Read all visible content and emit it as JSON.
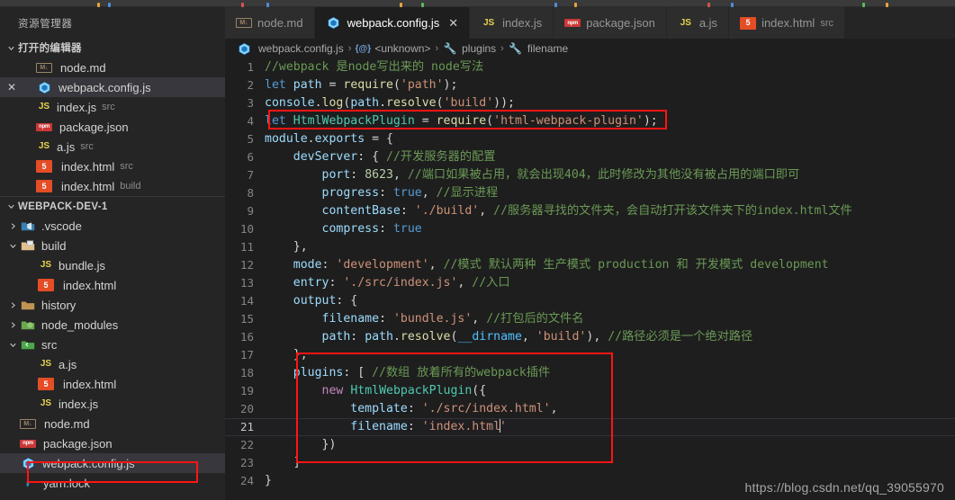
{
  "window": {
    "sidebar_title": "资源管理器"
  },
  "sidebar": {
    "open_editors_label": "打开的编辑器",
    "open_editors": [
      {
        "name": "node.md",
        "sub": "",
        "icon": "markdown-icon",
        "selected": false,
        "has_close": false
      },
      {
        "name": "webpack.config.js",
        "sub": "",
        "icon": "webpack-icon",
        "selected": true,
        "has_close": true
      },
      {
        "name": "index.js",
        "sub": "src",
        "icon": "js-icon",
        "selected": false,
        "has_close": false
      },
      {
        "name": "package.json",
        "sub": "",
        "icon": "npm-icon",
        "selected": false,
        "has_close": false
      },
      {
        "name": "a.js",
        "sub": "src",
        "icon": "js-icon",
        "selected": false,
        "has_close": false
      },
      {
        "name": "index.html",
        "sub": "src",
        "icon": "html-icon",
        "selected": false,
        "has_close": false
      },
      {
        "name": "index.html",
        "sub": "build",
        "icon": "html-icon",
        "selected": false,
        "has_close": false
      }
    ],
    "project_label": "WEBPACK-DEV-1",
    "tree": [
      {
        "name": ".vscode",
        "type": "folder",
        "state": "collapsed",
        "depth": 1,
        "icon": "folder-vscode-icon"
      },
      {
        "name": "build",
        "type": "folder",
        "state": "expanded",
        "depth": 1,
        "icon": "folder-build-icon"
      },
      {
        "name": "bundle.js",
        "type": "file",
        "depth": 2,
        "icon": "js-icon"
      },
      {
        "name": "index.html",
        "type": "file",
        "depth": 2,
        "icon": "html-icon"
      },
      {
        "name": "history",
        "type": "folder",
        "state": "collapsed",
        "depth": 1,
        "icon": "folder-icon"
      },
      {
        "name": "node_modules",
        "type": "folder",
        "state": "collapsed",
        "depth": 1,
        "icon": "folder-node-icon"
      },
      {
        "name": "src",
        "type": "folder",
        "state": "expanded",
        "depth": 1,
        "icon": "folder-src-icon"
      },
      {
        "name": "a.js",
        "type": "file",
        "depth": 2,
        "icon": "js-icon"
      },
      {
        "name": "index.html",
        "type": "file",
        "depth": 2,
        "icon": "html-icon"
      },
      {
        "name": "index.js",
        "type": "file",
        "depth": 2,
        "icon": "js-icon"
      },
      {
        "name": "node.md",
        "type": "file",
        "depth": 1,
        "icon": "markdown-icon"
      },
      {
        "name": "package.json",
        "type": "file",
        "depth": 1,
        "icon": "npm-icon"
      },
      {
        "name": "webpack.config.js",
        "type": "file",
        "depth": 1,
        "icon": "webpack-icon",
        "selected": true,
        "annotated": true
      },
      {
        "name": "yarn.lock",
        "type": "file",
        "depth": 1,
        "icon": "yarn-icon"
      }
    ]
  },
  "tabs": [
    {
      "label": "node.md",
      "sub": "",
      "icon": "markdown-icon",
      "active": false,
      "closable": false
    },
    {
      "label": "webpack.config.js",
      "sub": "",
      "icon": "webpack-icon",
      "active": true,
      "closable": true
    },
    {
      "label": "index.js",
      "sub": "",
      "icon": "js-icon",
      "active": false,
      "closable": false
    },
    {
      "label": "package.json",
      "sub": "",
      "icon": "npm-icon",
      "active": false,
      "closable": false
    },
    {
      "label": "a.js",
      "sub": "",
      "icon": "js-icon",
      "active": false,
      "closable": false
    },
    {
      "label": "index.html",
      "sub": "src",
      "icon": "html-icon",
      "active": false,
      "closable": false
    }
  ],
  "breadcrumb": [
    {
      "label": "webpack.config.js",
      "icon": "webpack-icon"
    },
    {
      "label": "<unknown>",
      "icon": "symbol-object-icon"
    },
    {
      "label": "plugins",
      "icon": "wrench-icon"
    },
    {
      "label": "filename",
      "icon": "wrench-icon"
    }
  ],
  "editor": {
    "language": "javascript",
    "active_line": 21,
    "cursor_line": 21,
    "lines": [
      {
        "n": 1,
        "tokens": [
          {
            "t": "//webpack 是node写出来的 node写法",
            "c": "cmt"
          }
        ]
      },
      {
        "n": 2,
        "tokens": [
          {
            "t": "let",
            "c": "kw"
          },
          {
            "t": " ",
            "c": "plain"
          },
          {
            "t": "path",
            "c": "var"
          },
          {
            "t": " = ",
            "c": "plain"
          },
          {
            "t": "require",
            "c": "fn"
          },
          {
            "t": "(",
            "c": "plain"
          },
          {
            "t": "'path'",
            "c": "str"
          },
          {
            "t": ");",
            "c": "plain"
          }
        ]
      },
      {
        "n": 3,
        "tokens": [
          {
            "t": "console",
            "c": "var"
          },
          {
            "t": ".",
            "c": "plain"
          },
          {
            "t": "log",
            "c": "fn"
          },
          {
            "t": "(",
            "c": "plain"
          },
          {
            "t": "path",
            "c": "var"
          },
          {
            "t": ".",
            "c": "plain"
          },
          {
            "t": "resolve",
            "c": "fn"
          },
          {
            "t": "(",
            "c": "plain"
          },
          {
            "t": "'build'",
            "c": "str"
          },
          {
            "t": "));",
            "c": "plain"
          }
        ]
      },
      {
        "n": 4,
        "tokens": [
          {
            "t": "let",
            "c": "kw"
          },
          {
            "t": " ",
            "c": "plain"
          },
          {
            "t": "HtmlWebpackPlugin",
            "c": "cls"
          },
          {
            "t": " = ",
            "c": "plain"
          },
          {
            "t": "require",
            "c": "fn"
          },
          {
            "t": "(",
            "c": "plain"
          },
          {
            "t": "'html-webpack-plugin'",
            "c": "str"
          },
          {
            "t": ");",
            "c": "plain"
          }
        ]
      },
      {
        "n": 5,
        "tokens": [
          {
            "t": "module",
            "c": "var"
          },
          {
            "t": ".",
            "c": "plain"
          },
          {
            "t": "exports",
            "c": "var"
          },
          {
            "t": " = {",
            "c": "plain"
          }
        ]
      },
      {
        "n": 6,
        "tokens": [
          {
            "t": "    ",
            "c": "plain"
          },
          {
            "t": "devServer",
            "c": "var"
          },
          {
            "t": ": { ",
            "c": "plain"
          },
          {
            "t": "//开发服务器的配置",
            "c": "cmt"
          }
        ]
      },
      {
        "n": 7,
        "tokens": [
          {
            "t": "        ",
            "c": "plain"
          },
          {
            "t": "port",
            "c": "var"
          },
          {
            "t": ": ",
            "c": "plain"
          },
          {
            "t": "8623",
            "c": "num"
          },
          {
            "t": ", ",
            "c": "plain"
          },
          {
            "t": "//端口如果被占用，就会出现404，此时修改为其他没有被占用的端口即可",
            "c": "cmt"
          }
        ]
      },
      {
        "n": 8,
        "tokens": [
          {
            "t": "        ",
            "c": "plain"
          },
          {
            "t": "progress",
            "c": "var"
          },
          {
            "t": ": ",
            "c": "plain"
          },
          {
            "t": "true",
            "c": "kw"
          },
          {
            "t": ", ",
            "c": "plain"
          },
          {
            "t": "//显示进程",
            "c": "cmt"
          }
        ]
      },
      {
        "n": 9,
        "tokens": [
          {
            "t": "        ",
            "c": "plain"
          },
          {
            "t": "contentBase",
            "c": "var"
          },
          {
            "t": ": ",
            "c": "plain"
          },
          {
            "t": "'./build'",
            "c": "str"
          },
          {
            "t": ", ",
            "c": "plain"
          },
          {
            "t": "//服务器寻找的文件夹，会自动打开该文件夹下的index.html文件",
            "c": "cmt"
          }
        ]
      },
      {
        "n": 10,
        "tokens": [
          {
            "t": "        ",
            "c": "plain"
          },
          {
            "t": "compress",
            "c": "var"
          },
          {
            "t": ": ",
            "c": "plain"
          },
          {
            "t": "true",
            "c": "kw"
          }
        ]
      },
      {
        "n": 11,
        "tokens": [
          {
            "t": "    },",
            "c": "plain"
          }
        ]
      },
      {
        "n": 12,
        "tokens": [
          {
            "t": "    ",
            "c": "plain"
          },
          {
            "t": "mode",
            "c": "var"
          },
          {
            "t": ": ",
            "c": "plain"
          },
          {
            "t": "'development'",
            "c": "str"
          },
          {
            "t": ", ",
            "c": "plain"
          },
          {
            "t": "//模式 默认两种 生产模式 production 和 开发模式 development",
            "c": "cmt"
          }
        ]
      },
      {
        "n": 13,
        "tokens": [
          {
            "t": "    ",
            "c": "plain"
          },
          {
            "t": "entry",
            "c": "var"
          },
          {
            "t": ": ",
            "c": "plain"
          },
          {
            "t": "'./src/index.js'",
            "c": "str"
          },
          {
            "t": ", ",
            "c": "plain"
          },
          {
            "t": "//入口",
            "c": "cmt"
          }
        ]
      },
      {
        "n": 14,
        "tokens": [
          {
            "t": "    ",
            "c": "plain"
          },
          {
            "t": "output",
            "c": "var"
          },
          {
            "t": ": {",
            "c": "plain"
          }
        ]
      },
      {
        "n": 15,
        "tokens": [
          {
            "t": "        ",
            "c": "plain"
          },
          {
            "t": "filename",
            "c": "var"
          },
          {
            "t": ": ",
            "c": "plain"
          },
          {
            "t": "'bundle.js'",
            "c": "str"
          },
          {
            "t": ", ",
            "c": "plain"
          },
          {
            "t": "//打包后的文件名",
            "c": "cmt"
          }
        ]
      },
      {
        "n": 16,
        "tokens": [
          {
            "t": "        ",
            "c": "plain"
          },
          {
            "t": "path",
            "c": "var"
          },
          {
            "t": ": ",
            "c": "plain"
          },
          {
            "t": "path",
            "c": "var"
          },
          {
            "t": ".",
            "c": "plain"
          },
          {
            "t": "resolve",
            "c": "fn"
          },
          {
            "t": "(",
            "c": "plain"
          },
          {
            "t": "__dirname",
            "c": "const"
          },
          {
            "t": ", ",
            "c": "plain"
          },
          {
            "t": "'build'",
            "c": "str"
          },
          {
            "t": "), ",
            "c": "plain"
          },
          {
            "t": "//路径必须是一个绝对路径",
            "c": "cmt"
          }
        ]
      },
      {
        "n": 17,
        "tokens": [
          {
            "t": "    },",
            "c": "plain"
          }
        ]
      },
      {
        "n": 18,
        "tokens": [
          {
            "t": "    ",
            "c": "plain"
          },
          {
            "t": "plugins",
            "c": "var"
          },
          {
            "t": ": [ ",
            "c": "plain"
          },
          {
            "t": "//数组 放着所有的webpack插件",
            "c": "cmt"
          }
        ]
      },
      {
        "n": 19,
        "tokens": [
          {
            "t": "        ",
            "c": "plain"
          },
          {
            "t": "new",
            "c": "kw2"
          },
          {
            "t": " ",
            "c": "plain"
          },
          {
            "t": "HtmlWebpackPlugin",
            "c": "cls"
          },
          {
            "t": "({",
            "c": "plain"
          }
        ]
      },
      {
        "n": 20,
        "tokens": [
          {
            "t": "            ",
            "c": "plain"
          },
          {
            "t": "template",
            "c": "var"
          },
          {
            "t": ": ",
            "c": "plain"
          },
          {
            "t": "'./src/index.html'",
            "c": "str"
          },
          {
            "t": ",",
            "c": "plain"
          }
        ]
      },
      {
        "n": 21,
        "tokens": [
          {
            "t": "            ",
            "c": "plain"
          },
          {
            "t": "filename",
            "c": "var"
          },
          {
            "t": ": ",
            "c": "plain"
          },
          {
            "t": "'index.html",
            "c": "str"
          },
          {
            "t": "|caret|",
            "c": "caret"
          },
          {
            "t": "'",
            "c": "str"
          }
        ]
      },
      {
        "n": 22,
        "tokens": [
          {
            "t": "        })",
            "c": "plain"
          }
        ]
      },
      {
        "n": 23,
        "tokens": [
          {
            "t": "    ]",
            "c": "plain"
          }
        ]
      },
      {
        "n": 24,
        "tokens": [
          {
            "t": "}",
            "c": "plain"
          }
        ]
      }
    ],
    "annotations": [
      {
        "name": "highlight-line-4",
        "line": 4
      },
      {
        "name": "highlight-plugins-block",
        "from": 18,
        "to": 23
      }
    ]
  },
  "watermark": "https://blog.csdn.net/qq_39055970",
  "colors": {
    "editor_bg": "#1e1e1e",
    "sidebar_bg": "#252526",
    "tabbar_bg": "#252526",
    "accent_red": "#ff1414",
    "selection": "#37373d"
  }
}
